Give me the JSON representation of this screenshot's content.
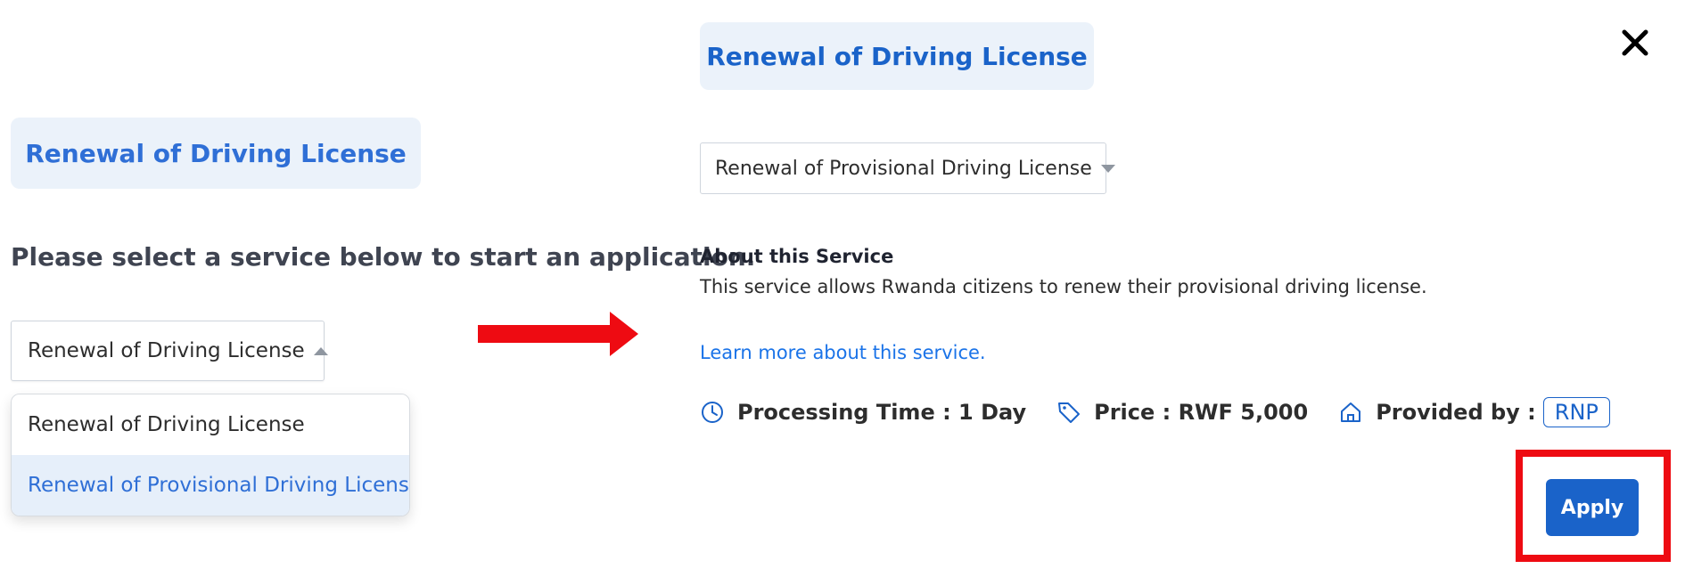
{
  "left": {
    "title": "Renewal of Driving License",
    "prompt": "Please select a service below to start an application.",
    "select": {
      "value": "Renewal of Driving License",
      "options": [
        "Renewal of Driving License",
        "Renewal of Provisional Driving License"
      ]
    }
  },
  "right": {
    "title": "Renewal of Driving License",
    "select": {
      "value": "Renewal of Provisional Driving License"
    },
    "about": {
      "heading": "About this Service",
      "description": "This service allows Rwanda citizens to renew their provisional driving license.",
      "learn_more": "Learn more about this service."
    },
    "info": {
      "processing_time": "Processing Time : 1 Day",
      "price": "Price : RWF 5,000",
      "provided_by_label": "Provided by :",
      "provider": "RNP"
    },
    "apply_label": "Apply"
  },
  "icons": {
    "close": "close-icon",
    "clock": "clock-icon",
    "tag": "price-tag-icon",
    "home": "home-icon",
    "arrow": "right-arrow-icon"
  },
  "colors": {
    "accent": "#1a63c9",
    "pill_bg": "#ebf2fa",
    "highlight_red": "#ee0b12"
  }
}
